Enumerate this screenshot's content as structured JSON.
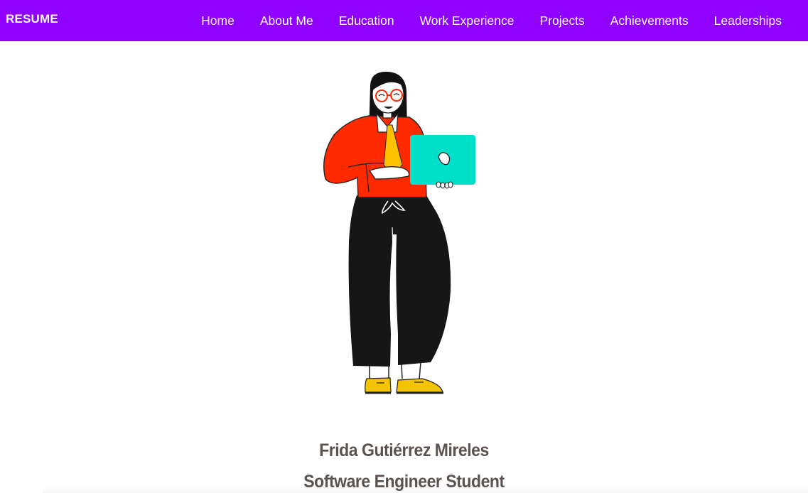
{
  "navbar": {
    "brand": "RESUME",
    "links": [
      {
        "label": "Home"
      },
      {
        "label": "About Me"
      },
      {
        "label": "Education"
      },
      {
        "label": "Work Experience"
      },
      {
        "label": "Projects"
      },
      {
        "label": "Achievements"
      },
      {
        "label": "Leaderships"
      }
    ],
    "background_color": "#8f00ff"
  },
  "hero": {
    "illustration": "woman-holding-laptop-illustration",
    "name": "Frida Gutiérrez Mireles",
    "role": "Software Engineer Student",
    "text_color": "#5a5350"
  }
}
